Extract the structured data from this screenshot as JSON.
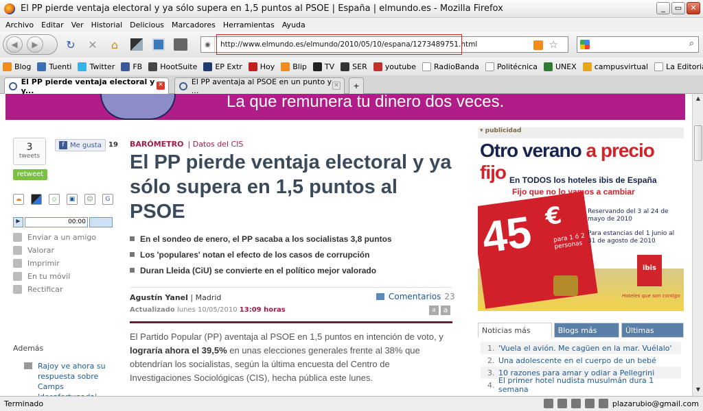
{
  "window": {
    "title": "El PP pierde ventaja electoral y ya sólo supera en 1,5 puntos al PSOE | España | elmundo.es - Mozilla Firefox",
    "controls": [
      "_",
      "▭",
      "✕"
    ]
  },
  "menu": [
    "Archivo",
    "Editar",
    "Ver",
    "Historial",
    "Delicious",
    "Marcadores",
    "Herramientas",
    "Ayuda"
  ],
  "toolbar": {
    "url": "http://www.elmundo.es/elmundo/2010/05/10/espana/1273489751.html"
  },
  "bookmarks": [
    {
      "label": "Blog",
      "color": "#f28b1a"
    },
    {
      "label": "Tuenti",
      "color": "#3a6fb0"
    },
    {
      "label": "Twitter",
      "color": "#33b5e5"
    },
    {
      "label": "FB",
      "color": "#3b5998"
    },
    {
      "label": "HootSuite",
      "color": "#444444"
    },
    {
      "label": "EP Extr",
      "color": "#1c3a6e"
    },
    {
      "label": "Hoy",
      "color": "#c41e1e"
    },
    {
      "label": "Blip",
      "color": "#f28b1a"
    },
    {
      "label": "TV",
      "color": "#222222"
    },
    {
      "label": "SER",
      "color": "#333333"
    },
    {
      "label": "youtube",
      "color": "#c4302b"
    },
    {
      "label": "RadioBanda",
      "color": "#ffffff"
    },
    {
      "label": "Politécnica",
      "color": "#ffffff"
    },
    {
      "label": "UNEX",
      "color": "#2e7d32"
    },
    {
      "label": "campusvirtual",
      "color": "#e6a817"
    },
    {
      "label": "La Editorial Virtual",
      "color": "#ffffff"
    }
  ],
  "tabs": [
    {
      "label": "El PP pierde ventaja electoral y y...",
      "active": true
    },
    {
      "label": "El PP aventaja al PSOE en un punto y ...",
      "active": false
    }
  ],
  "newtab": "+",
  "status": {
    "text": "Terminado",
    "email": "plazarubio@gmail.com"
  },
  "banner": {
    "text": "La que remunera tu dinero dos veces."
  },
  "share": {
    "count": "3",
    "count_label": "tweets",
    "retweet": "retweet",
    "like_label": "Me gusta",
    "like_count": "19"
  },
  "social_icons": [
    "G"
  ],
  "player": {
    "time": "00:00"
  },
  "tools": [
    "Enviar a un amigo",
    "Valorar",
    "Imprimir",
    "En tu móvil",
    "Rectificar"
  ],
  "ademas": {
    "title": "Además",
    "item": "Rajoy ve ahora su respuesta sobre Camps 'desafortunada'"
  },
  "article": {
    "kicker": "BARÓMETRO",
    "kicker_sub": "| Datos del CIS",
    "headline": "El PP pierde ventaja electoral y ya sólo supera en 1,5 puntos al PSOE",
    "bullets": [
      "En el sondeo de enero, el PP sacaba a los socialistas 3,8 puntos",
      "Los 'populares' notan el efecto de los casos de corrupción",
      "Duran Lleida (CiU) se convierte en el político mejor valorado"
    ],
    "author": "Agustín Yanel",
    "location": "| Madrid",
    "updated_label": "Actualizado",
    "updated_date": "lunes 10/05/2010",
    "updated_time": "13:09 horas",
    "comments_label": "Comentarios",
    "comments_count": "23",
    "font_buttons": [
      "a",
      "a"
    ],
    "body_1": "El Partido Popular (PP) aventaja al PSOE en 1,5 puntos en intención de voto, y ",
    "body_bold": "lograría ahora el 39,5%",
    "body_2": " en unas elecciones generales frente al 38% que obtendrían los socialistas, según la última encuesta del Centro de Investigaciones Sociológicas (CIS), hecha pública este lunes."
  },
  "ad": {
    "label": "publicidad",
    "title_a": "Otro verano ",
    "title_b": "a precio fijo",
    "line2": "En TODOS los hoteles ibis de España",
    "line3": "Fijo que no lo vamos a cambiar",
    "price": "45",
    "currency": "€",
    "per": "para 1 ó 2 personas",
    "b1": "Reservando del 3 al 24 de mayo de 2010",
    "b2": "Para estancias del 1 junio al 31 de agosto de 2010",
    "brand": "ibis",
    "slogan": "Hoteles que son contigo"
  },
  "most_tabs": [
    "Noticias más leídas",
    "Blogs más leídos",
    "Últimas noticias"
  ],
  "most_list": [
    {
      "n": "1.",
      "t": "'Vuela el avión. Me cagüen en la mar. Vuélalo'"
    },
    {
      "n": "2.",
      "t": "Una adolescente en el cuerpo de un bebé"
    },
    {
      "n": "3.",
      "t": "10 razones para amar y odiar a Pellegrini"
    },
    {
      "n": "4.",
      "t": "El primer hotel nudista musulmán dura 1 semana"
    }
  ]
}
